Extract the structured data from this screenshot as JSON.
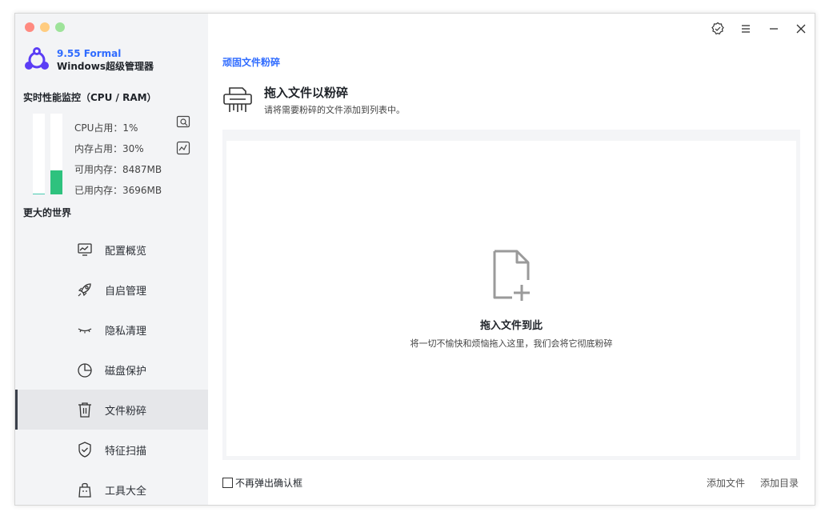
{
  "app": {
    "version": "9.55 Formal",
    "name": "Windows超级管理器"
  },
  "colors": {
    "accent": "#2f6bff",
    "ram_bar": "#2ec27e",
    "cpu_bar": "#48c9b0"
  },
  "monitor": {
    "title": "实时性能监控（CPU / RAM）",
    "cpu_percent": 1,
    "ram_percent": 30,
    "stats": [
      "CPU占用：1%",
      "内存占用：30%",
      "可用内存：8487MB",
      "已用内存：3696MB"
    ]
  },
  "sidebar": {
    "section": "更大的世界",
    "items": [
      {
        "label": "配置概览",
        "icon": "monitor-chart-icon"
      },
      {
        "label": "自启管理",
        "icon": "rocket-icon"
      },
      {
        "label": "隐私清理",
        "icon": "closed-eye-icon"
      },
      {
        "label": "磁盘保护",
        "icon": "pie-chart-icon"
      },
      {
        "label": "文件粉碎",
        "icon": "trash-icon"
      },
      {
        "label": "特征扫描",
        "icon": "shield-check-icon"
      },
      {
        "label": "工具大全",
        "icon": "bag-icon"
      }
    ],
    "active_index": 4
  },
  "main": {
    "breadcrumb": "顽固文件粉碎",
    "title": "拖入文件以粉碎",
    "subtitle": "请将需要粉碎的文件添加到列表中。",
    "drop_title": "拖入文件到此",
    "drop_subtitle": "将一切不愉快和烦恼拖入这里，我们会将它彻底粉碎",
    "checkbox_label": "不再弹出确认框",
    "add_file": "添加文件",
    "add_dir": "添加目录"
  }
}
